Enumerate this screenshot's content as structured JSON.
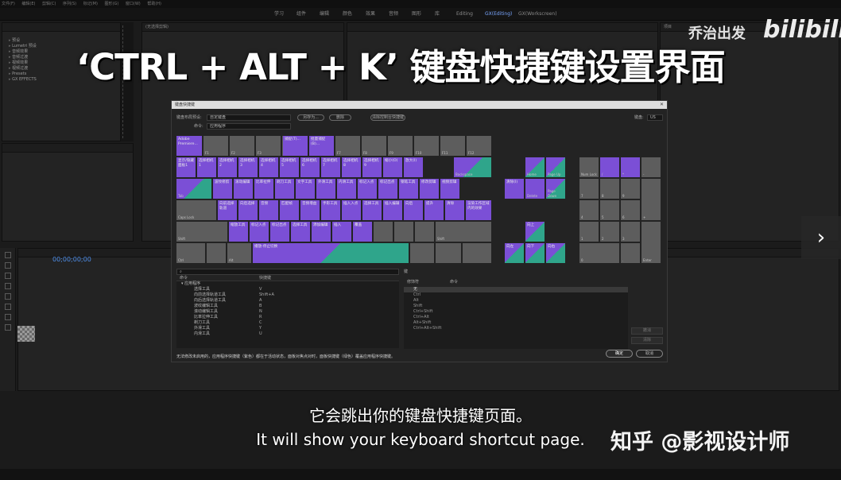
{
  "app_menu": [
    "文件(F)",
    "编辑(E)",
    "剪辑(C)",
    "序列(S)",
    "标记(M)",
    "图形(G)",
    "窗口(W)",
    "帮助(H)"
  ],
  "workspaces": [
    {
      "label": "学习",
      "active": false
    },
    {
      "label": "组件",
      "active": false
    },
    {
      "label": "编辑",
      "active": false
    },
    {
      "label": "颜色",
      "active": false
    },
    {
      "label": "效果",
      "active": false
    },
    {
      "label": "音频",
      "active": false
    },
    {
      "label": "图形",
      "active": false
    },
    {
      "label": "库",
      "active": false
    },
    {
      "label": "Editing",
      "active": false
    },
    {
      "label": "GX(Editing)",
      "active": true
    },
    {
      "label": "GX(Workscreen)",
      "active": false
    }
  ],
  "effects_panel": {
    "items": [
      "预设",
      "Lumetri 预设",
      "音频效果",
      "音频过渡",
      "视频效果",
      "视频过渡",
      "Presets",
      "GX EFFECTS"
    ]
  },
  "source_panel": {
    "title": "(无选择剪辑)"
  },
  "project_panel": {
    "title": "项目",
    "tabs": [
      "媒体浏览",
      "信息",
      "效果"
    ]
  },
  "timeline": {
    "timecode": "00;00;00;00"
  },
  "banner": "‘CTRL + ALT + K’ 键盘快捷键设置界面",
  "watermark": {
    "line1": "乔治出发",
    "line2": "bilibili"
  },
  "next_arrow": "›",
  "dialog": {
    "title": "键盘快捷键",
    "close": "✕",
    "layout_preset_label": "键盘布局预设:",
    "layout_preset_value": "自定键盘",
    "save_as": "另存为...",
    "delete": "删除",
    "clear_console": "清除控制台快捷键",
    "command_label": "命令:",
    "command_value": "应用程序",
    "keyboard_label": "键盘:",
    "keyboard_value": "US",
    "keys": {
      "esc": "Adobe Premiere...",
      "f_row": [
        "F1",
        "F2",
        "F3",
        "F4",
        "F5",
        "F6",
        "F7",
        "F8",
        "F9",
        "F10",
        "F11",
        "F12"
      ],
      "f5": "捕捉(T)...",
      "f6": "批量捕捉(B)...",
      "num_row": [
        "显示/隐藏面板1",
        "选择相机1",
        "选择相机2",
        "选择相机3",
        "选择相机4",
        "选择相机5",
        "选择相机6",
        "选择相机7",
        "选择相机8",
        "选择相机9",
        "缩小(O)",
        "放大(I)"
      ],
      "backspace": "Backspace",
      "q_row": [
        "波纹修剪",
        "滚动编辑",
        "比率拉伸",
        "剃刀工具",
        "文字工具",
        "外滑工具",
        "内滑工具",
        "标记入点",
        "标记出点",
        "钢笔工具",
        "修改剪辑",
        "视频剪辑"
      ],
      "a_row": [
        "向前选择轨道",
        "向后选择",
        "音频",
        "匹配帧",
        "音频增益",
        "手形工具",
        "插入入点",
        "选择工具",
        "插入编辑",
        "向后",
        "提升",
        "清除"
      ],
      "enter": "渲染工作区域内的效果",
      "z_row": [
        "缩放工具",
        "标记入点",
        "标记出点",
        "选择工具",
        "添加编辑",
        "插入",
        "覆盖"
      ],
      "space": "播放-停止切换",
      "tab": "Tab",
      "caps": "Caps Lock",
      "shift_l": "Shift",
      "shift_r": "Shift",
      "ctrl": "Ctrl",
      "alt": "Alt",
      "nav": [
        "清除(I)",
        "Home",
        "Page Up",
        "Delete",
        "End",
        "Page Down"
      ],
      "arrows": [
        "向上",
        "向左",
        "向下",
        "向右"
      ],
      "numpad": [
        "Num Lock",
        "/",
        "*",
        "-",
        "7",
        "8",
        "9",
        "+",
        "4",
        "5",
        "6",
        "1",
        "2",
        "3",
        "Enter",
        "0",
        "."
      ]
    },
    "search_icon": "search-icon",
    "cmd_header": {
      "command": "命令",
      "shortcut": "快捷键"
    },
    "mod_header": {
      "key": "键",
      "modifier": "修饰符",
      "command": "命令"
    },
    "commands": [
      {
        "name": "▾ 应用程序",
        "shortcut": ""
      },
      {
        "name": "选择工具",
        "shortcut": "V"
      },
      {
        "name": "向前选择轨道工具",
        "shortcut": "Shift+A"
      },
      {
        "name": "向后选择轨道工具",
        "shortcut": "A"
      },
      {
        "name": "波纹编辑工具",
        "shortcut": "B"
      },
      {
        "name": "滚动编辑工具",
        "shortcut": "N"
      },
      {
        "name": "比率拉伸工具",
        "shortcut": "R"
      },
      {
        "name": "剃刀工具",
        "shortcut": "C"
      },
      {
        "name": "外滑工具",
        "shortcut": "Y"
      },
      {
        "name": "内滑工具",
        "shortcut": "U"
      }
    ],
    "modifiers": [
      "无",
      "Ctrl",
      "Alt",
      "Shift",
      "Ctrl+Shift",
      "Ctrl+Alt",
      "Alt+Shift",
      "Ctrl+Alt+Shift"
    ],
    "side_buttons": [
      "撤消",
      "清除"
    ],
    "note": "无法修改未启用的，应用程序快捷键（紫色）都在于活动状态，面板对焦点对时，面板快捷键（绿色）覆盖应用程序快捷键。",
    "ok": "确定",
    "cancel": "取消"
  },
  "subtitles": {
    "cn": "它会跳出你的键盘快捷键页面。",
    "en": "It will show your keyboard shortcut page."
  },
  "zhihu": "知乎 @影视设计师",
  "colors": {
    "app_key": "#7b4fd6",
    "panel_key": "#2fa58b",
    "accent": "#4d8de8"
  }
}
